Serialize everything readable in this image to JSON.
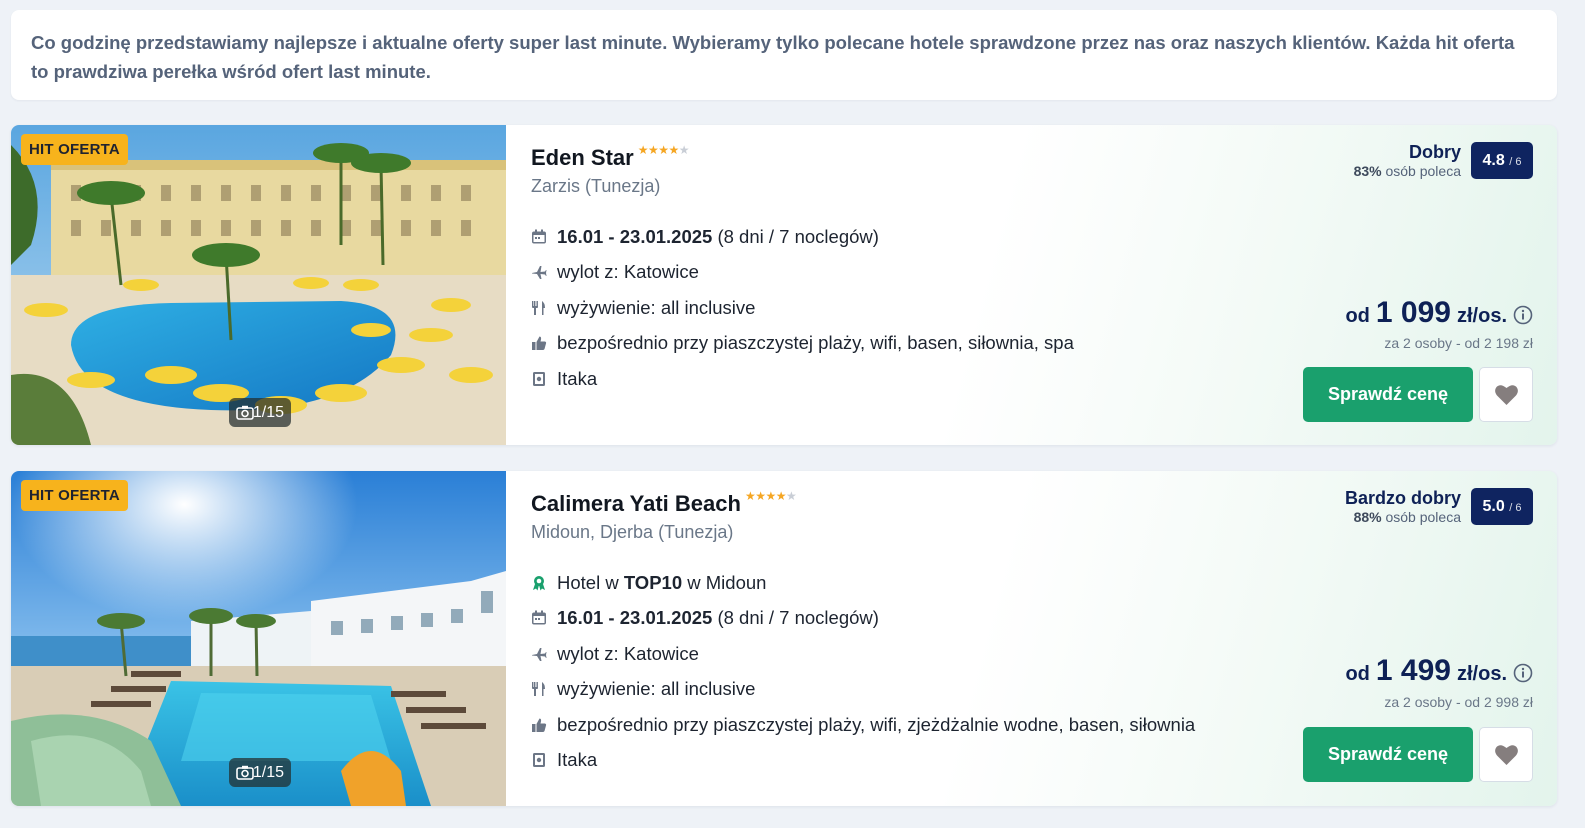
{
  "intro": {
    "text": "Co godzinę przedstawiamy najlepsze i aktualne oferty super last minute. Wybieramy tylko polecane hotele sprawdzone przez nas oraz naszych klientów. Każda hit oferta to prawdziwa perełka wśród ofert last minute."
  },
  "offers": [
    {
      "badge": "HIT OFERTA",
      "photo_count": "1/15",
      "name": "Eden Star",
      "stars": 4,
      "location": "Zarzis (Tunezja)",
      "dates": "16.01 - 23.01.2025",
      "duration": "(8 dni / 7 noclegów)",
      "departure": "wylot z: Katowice",
      "board": "wyżywienie: all inclusive",
      "highlights": "bezpośrednio przy piaszczystej plaży, wifi, basen, siłownia, spa",
      "operator": "Itaka",
      "rating_label": "Dobry",
      "recommend_pct": "83%",
      "recommend_text": "osób poleca",
      "score": "4.8",
      "score_max": "/ 6",
      "price_prefix": "od",
      "price": "1 099",
      "price_unit": "zł/os.",
      "price_sub": "za 2 osoby - od 2 198 zł",
      "cta": "Sprawdź cenę"
    },
    {
      "badge": "HIT OFERTA",
      "photo_count": "1/15",
      "name": "Calimera Yati Beach",
      "stars": 4,
      "location": "Midoun, Djerba (Tunezja)",
      "top_prefix": "Hotel w",
      "top_rank": "TOP10",
      "top_suffix": "w Midoun",
      "dates": "16.01 - 23.01.2025",
      "duration": "(8 dni / 7 noclegów)",
      "departure": "wylot z: Katowice",
      "board": "wyżywienie: all inclusive",
      "highlights": "bezpośrednio przy piaszczystej plaży, wifi, zjeżdżalnie wodne, basen, siłownia",
      "operator": "Itaka",
      "rating_label": "Bardzo dobry",
      "recommend_pct": "88%",
      "recommend_text": "osób poleca",
      "score": "5.0",
      "score_max": "/ 6",
      "price_prefix": "od",
      "price": "1 499",
      "price_unit": "zł/os.",
      "price_sub": "za 2 osoby - od 2 998 zł",
      "cta": "Sprawdź cenę"
    }
  ],
  "colors": {
    "navy": "#0e2156",
    "score_bg": "#0f2460",
    "cta_green": "#1aa06d",
    "badge_yellow": "#f7b31c",
    "star": "#f5a623"
  },
  "icons": [
    "calendar-icon",
    "plane-icon",
    "cutlery-icon",
    "thumbs-up-icon",
    "operator-icon",
    "trophy-icon",
    "camera-icon",
    "info-icon",
    "heart-icon"
  ]
}
